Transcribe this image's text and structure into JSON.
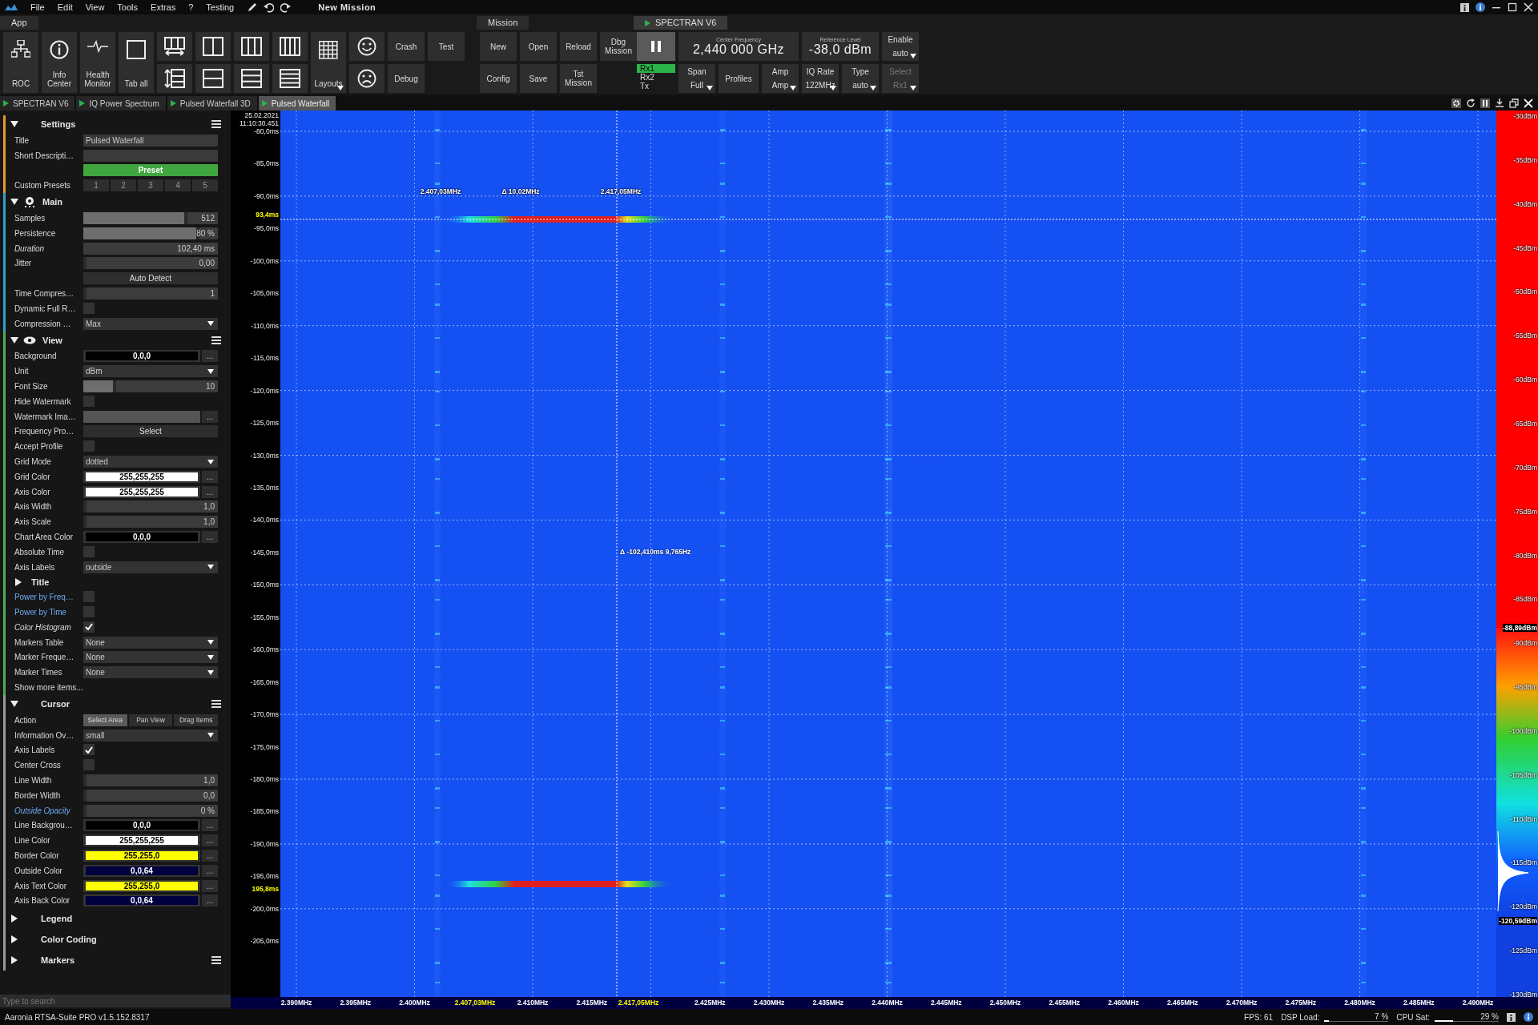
{
  "menu_bar": {
    "items": [
      "File",
      "Edit",
      "View",
      "Tools",
      "Extras",
      "?",
      "Testing"
    ],
    "mission_title": "New Mission"
  },
  "app": {
    "label": "App",
    "tools": [
      "ROC",
      "Info Center",
      "Health Monitor",
      "Tab all"
    ],
    "layouts": "Layouts",
    "debug_buttons": [
      [
        "Crash",
        "Debug"
      ],
      [
        "Test"
      ]
    ]
  },
  "mission": {
    "label": "Mission",
    "buttons": [
      [
        "New",
        "Config"
      ],
      [
        "Open",
        "Save"
      ],
      [
        "Reload",
        "Tst Mission"
      ],
      [
        "Dbg Mission"
      ]
    ]
  },
  "device": {
    "tab": "SPECTRAN V6",
    "channels": [
      {
        "label": "Rx1",
        "selected": true
      },
      {
        "label": "Rx2",
        "selected": false
      },
      {
        "label": "Tx",
        "selected": false
      }
    ],
    "center_frequency": {
      "label": "Center Frequency",
      "value": "2,440 000 GHz"
    },
    "reference_level": {
      "label": "Reference Level",
      "value": "-38,0 dBm"
    },
    "enable": {
      "label": "Enable",
      "value": "auto",
      "disabled": false
    },
    "controls": [
      {
        "kind": "dropdown",
        "label": "Span",
        "value": "Full",
        "disabled": false
      },
      {
        "kind": "button",
        "label": "Profiles"
      },
      {
        "kind": "dropdown",
        "label": "Amp",
        "value": "Amp",
        "disabled": false
      },
      {
        "kind": "dropdown",
        "label": "IQ Rate",
        "value": "122MHz",
        "disabled": false
      },
      {
        "kind": "dropdown",
        "label": "Type",
        "value": "auto",
        "disabled": false
      },
      {
        "kind": "dropdown",
        "label": "Select",
        "value": "Rx1",
        "disabled": true
      }
    ]
  },
  "doc_tabs": [
    {
      "label": "SPECTRAN V6",
      "selected": false
    },
    {
      "label": "IQ Power Spectrum",
      "selected": false
    },
    {
      "label": "Pulsed Waterfall 3D",
      "selected": false
    },
    {
      "label": "Pulsed Waterfall",
      "selected": true
    }
  ],
  "settings_panel": {
    "sections": [
      {
        "title": "Settings",
        "color": "#e8962e",
        "expanded": true,
        "menu": true,
        "rows": [
          {
            "kind": "text",
            "label": "Title",
            "value": "Pulsed Waterfall"
          },
          {
            "kind": "text",
            "label": "Short Descripti…"
          },
          {
            "kind": "button",
            "text": "Preset",
            "primary": true
          },
          {
            "kind": "presets",
            "label": "Custom Presets",
            "options": [
              "1",
              "2",
              "3",
              "4",
              "5"
            ]
          }
        ]
      },
      {
        "title": "Main",
        "color": "#2aa3c8",
        "expanded": true,
        "menu": false,
        "rows": [
          {
            "kind": "slider",
            "label": "Samples",
            "level": 0.75,
            "value": "512"
          },
          {
            "kind": "slider",
            "label": "Persistence",
            "level": 0.84,
            "value": "80 %"
          },
          {
            "kind": "number",
            "label": "Duration",
            "value": "102,40 ms",
            "italic": true
          },
          {
            "kind": "slider",
            "label": "Jitter",
            "level": 0,
            "value": "0,00"
          },
          {
            "kind": "button",
            "text": "Auto Detect",
            "primary": false
          },
          {
            "kind": "slider",
            "label": "Time Compres…",
            "level": 0,
            "value": "1"
          },
          {
            "kind": "checkbox",
            "label": "Dynamic Full R…",
            "checked": false
          },
          {
            "kind": "select",
            "label": "Compression …",
            "value": "Max"
          }
        ]
      },
      {
        "title": "View",
        "color": "#4caf50",
        "expanded": true,
        "menu": true,
        "rows": [
          {
            "kind": "color",
            "label": "Background",
            "value": "0,0,0",
            "color": "#000000",
            "more": "..."
          },
          {
            "kind": "select",
            "label": "Unit",
            "value": "dBm"
          },
          {
            "kind": "slider",
            "label": "Font Size",
            "level": 0.22,
            "value": "10"
          },
          {
            "kind": "checkbox",
            "label": "Hide Watermark",
            "checked": false
          },
          {
            "kind": "file",
            "label": "Watermark Ima…",
            "more": "..."
          },
          {
            "kind": "button",
            "label": "Frequency Pro…",
            "text": "Select",
            "primary": false
          },
          {
            "kind": "checkbox",
            "label": "Accept Profile",
            "checked": false
          },
          {
            "kind": "select",
            "label": "Grid Mode",
            "value": "dotted"
          },
          {
            "kind": "color",
            "label": "Grid Color",
            "value": "255,255,255",
            "color": "#ffffff",
            "more": "..."
          },
          {
            "kind": "color",
            "label": "Axis Color",
            "value": "255,255,255",
            "color": "#ffffff",
            "more": "..."
          },
          {
            "kind": "slider",
            "label": "Axis Width",
            "level": 0,
            "value": "1,0"
          },
          {
            "kind": "slider",
            "label": "Axis Scale",
            "level": 0,
            "value": "1,0"
          },
          {
            "kind": "color",
            "label": "Chart Area Color",
            "value": "0,0,0",
            "color": "#000000",
            "more": "..."
          },
          {
            "kind": "checkbox",
            "label": "Absolute Time",
            "checked": false
          },
          {
            "kind": "select",
            "label": "Axis Labels",
            "value": "outside"
          },
          {
            "kind": "subsection",
            "title": "Title",
            "expanded": false
          },
          {
            "kind": "checkbox",
            "label": "Power by Freq…",
            "checked": false,
            "link": true
          },
          {
            "kind": "checkbox",
            "label": "Power by Time",
            "checked": false,
            "link": true
          },
          {
            "kind": "checkbox",
            "label": "Color Histogram",
            "checked": true,
            "italic": true
          },
          {
            "kind": "select",
            "label": "Markers Table",
            "value": "None"
          },
          {
            "kind": "select",
            "label": "Marker Freque…",
            "value": "None"
          },
          {
            "kind": "select",
            "label": "Marker Times",
            "value": "None"
          },
          {
            "kind": "link",
            "text": "Show more items..."
          }
        ]
      },
      {
        "title": "Cursor",
        "color": "#9a9a9a",
        "expanded": true,
        "menu": true,
        "rows": [
          {
            "kind": "segmented",
            "label": "Action",
            "options": [
              {
                "label": "Select Area",
                "selected": true
              },
              {
                "label": "Pan View",
                "selected": false
              },
              {
                "label": "Drag Items",
                "selected": false
              }
            ]
          },
          {
            "kind": "select",
            "label": "Information Ov…",
            "value": "small"
          },
          {
            "kind": "checkbox",
            "label": "Axis Labels",
            "checked": true
          },
          {
            "kind": "checkbox",
            "label": "Center Cross",
            "checked": false
          },
          {
            "kind": "slider",
            "label": "Line Width",
            "level": 0,
            "value": "1,0"
          },
          {
            "kind": "slider",
            "label": "Border Width",
            "level": 0,
            "value": "0,0"
          },
          {
            "kind": "slider",
            "label": "Outside Opacity",
            "level": 0,
            "value": "0 %",
            "italic": true,
            "link": true
          },
          {
            "kind": "color",
            "label": "Line Backgrou…",
            "value": "0,0,0",
            "color": "#000000",
            "more": "..."
          },
          {
            "kind": "color",
            "label": "Line Color",
            "value": "255,255,255",
            "color": "#ffffff",
            "more": "..."
          },
          {
            "kind": "color",
            "label": "Border Color",
            "value": "255,255,0",
            "color": "#ffff00",
            "more": "..."
          },
          {
            "kind": "color",
            "label": "Outside Color",
            "value": "0,0,64",
            "color": "#000040",
            "more": "..."
          },
          {
            "kind": "color",
            "label": "Axis Text Color",
            "value": "255,255,0",
            "color": "#ffff00",
            "more": "..."
          },
          {
            "kind": "color",
            "label": "Axis Back Color",
            "value": "0,0,64",
            "color": "#000040",
            "more": "..."
          }
        ]
      },
      {
        "title": "Legend",
        "color": "#9a9a9a",
        "expanded": false,
        "menu": false
      },
      {
        "title": "Color Coding",
        "color": "#9a9a9a",
        "expanded": false,
        "menu": false
      },
      {
        "title": "Markers",
        "color": "#9a9a9a",
        "expanded": false,
        "menu": true
      }
    ],
    "search": {
      "placeholder": "Type to search"
    }
  },
  "waterfall": {
    "date": "25.02.2021",
    "time": "11:10:30.451",
    "time_ticks": [
      "-80,0ms",
      "-85,0ms",
      "-90,0ms",
      "-95,0ms",
      "-100,0ms",
      "-105,0ms",
      "-110,0ms",
      "-115,0ms",
      "-120,0ms",
      "-125,0ms",
      "-130,0ms",
      "-135,0ms",
      "-140,0ms",
      "-145,0ms",
      "-150,0ms",
      "-155,0ms",
      "-160,0ms",
      "-165,0ms",
      "-170,0ms",
      "-175,0ms",
      "-180,0ms",
      "-185,0ms",
      "-190,0ms",
      "-195,0ms",
      "-200,0ms",
      "-205,0ms"
    ],
    "time_cursors": [
      "93,4ms",
      "195,8ms"
    ],
    "freq_ticks": [
      "2.390MHz",
      "2.395MHz",
      "2.400MHz",
      "2.410MHz",
      "2.415MHz",
      "2.425MHz",
      "2.430MHz",
      "2.435MHz",
      "2.440MHz",
      "2.445MHz",
      "2.450MHz",
      "2.455MHz",
      "2.460MHz",
      "2.465MHz",
      "2.470MHz",
      "2.475MHz",
      "2.480MHz",
      "2.485MHz",
      "2.490MHz"
    ],
    "freq_cursors": [
      "2.407,03MHz",
      "2.417,05MHz"
    ],
    "plot_labels": {
      "start": "2.407,03MHz",
      "delta": "Δ 10,02MHz",
      "end": "2.417,05MHz",
      "time_delta": "Δ -102,410ms 9,765Hz"
    }
  },
  "color_scale": {
    "ticks": [
      "-30dBm",
      "-35dBm",
      "-40dBm",
      "-45dBm",
      "-50dBm",
      "-55dBm",
      "-60dBm",
      "-65dBm",
      "-70dBm",
      "-75dBm",
      "-80dBm",
      "-85dBm",
      "-90dBm",
      "-95dBm",
      "-100dBm",
      "-105dBm",
      "-110dBm",
      "-115dBm",
      "-120dBm",
      "-125dBm",
      "-130dBm"
    ],
    "markers": [
      "-88,89dBm",
      "-120,59dBm"
    ]
  },
  "status_bar": {
    "version": "Aaronia RTSA-Suite PRO v1.5.152.8317",
    "fps": "FPS: 61",
    "meters": [
      {
        "label": "DSP Load:",
        "level": 0.07,
        "reading": "7 %"
      },
      {
        "label": "CPU Sat:",
        "level": 0.29,
        "reading": "29 %"
      }
    ]
  }
}
